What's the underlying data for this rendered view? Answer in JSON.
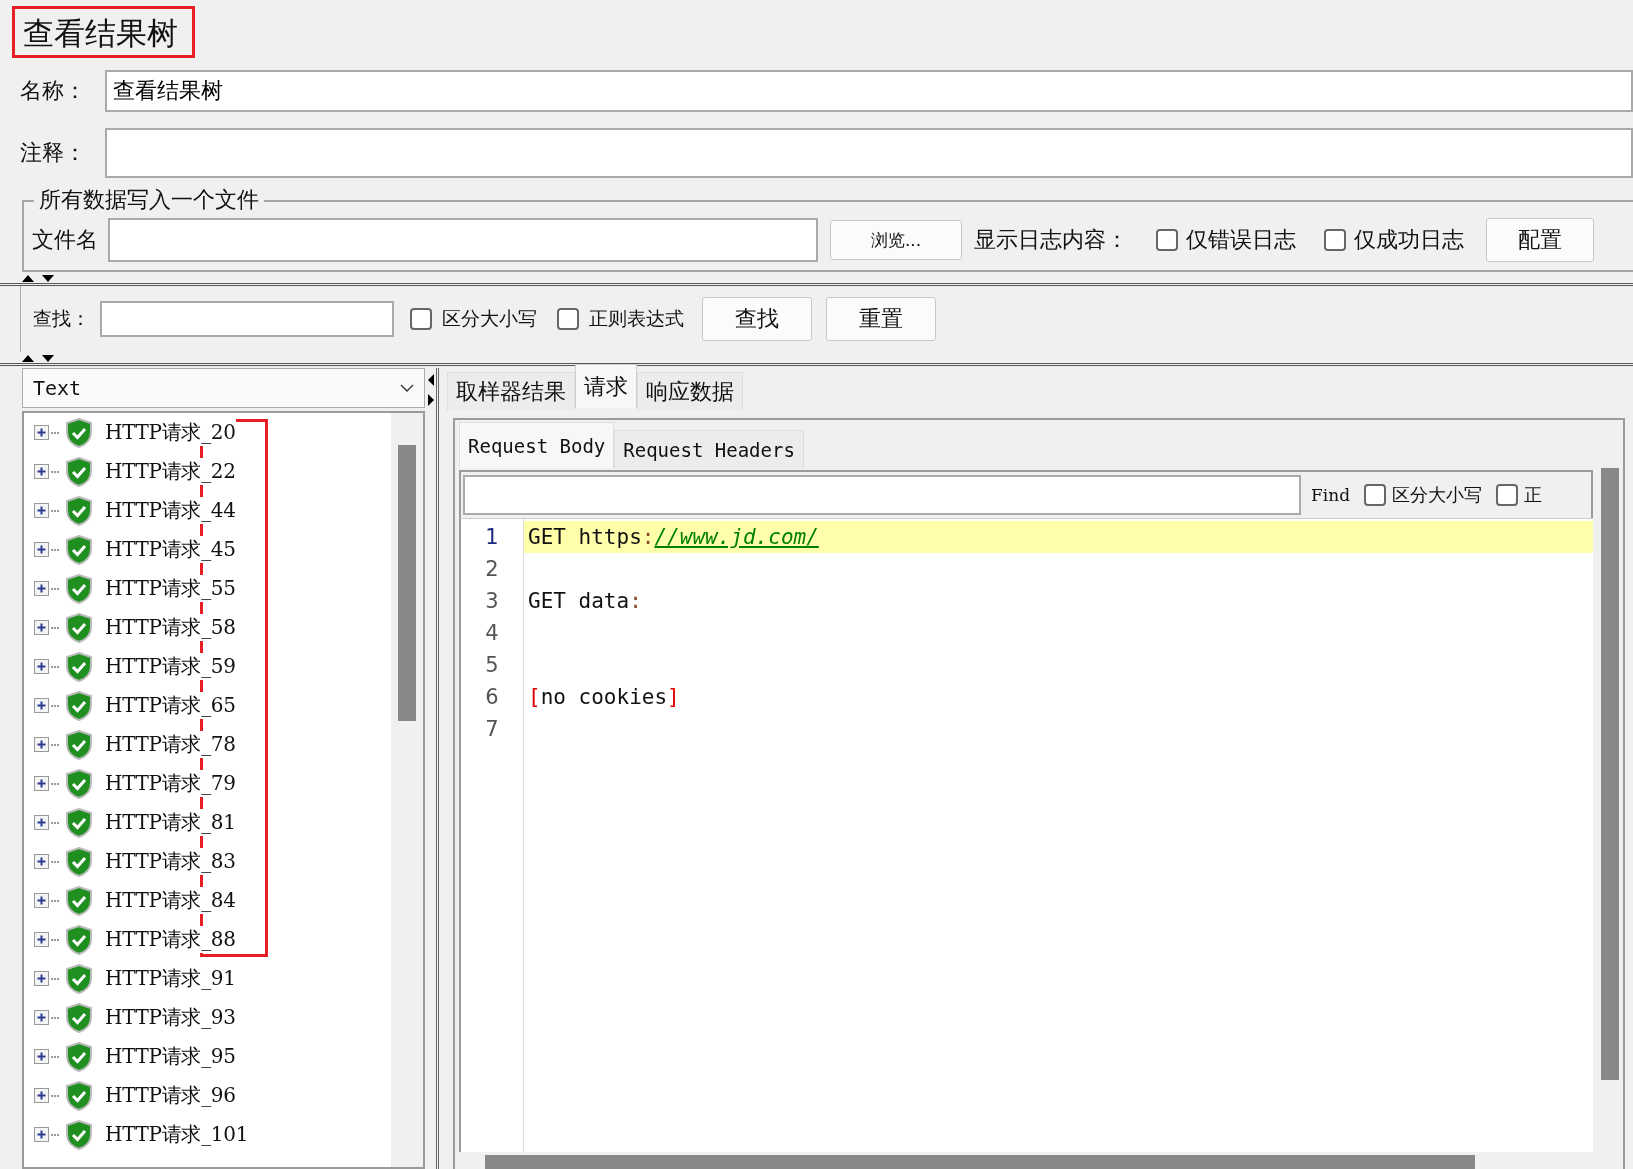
{
  "title": {
    "text": "查看结果树",
    "boxed": true
  },
  "name_field": {
    "label": "名称：",
    "value": "查看结果树"
  },
  "comment_field": {
    "label": "注释："
  },
  "file_section": {
    "legend": "所有数据写入一个文件",
    "file_label": "文件名",
    "browse_button": "浏览...",
    "log_label": "显示日志内容：",
    "checkboxes": [
      {
        "label": "仅错误日志",
        "checked": false
      },
      {
        "label": "仅成功日志",
        "checked": false
      }
    ],
    "config_button": "配置"
  },
  "search": {
    "label": "查找：",
    "checkboxes": [
      {
        "label": "区分大小写",
        "checked": false
      },
      {
        "label": "正则表达式",
        "checked": false
      }
    ],
    "buttons": [
      "查找",
      "重置"
    ]
  },
  "renderer_combo": {
    "value": "Text"
  },
  "tree": {
    "items": [
      {
        "label": "HTTP请求_20",
        "expanded": false,
        "marked": true
      },
      {
        "label": "HTTP请求_22",
        "expanded": false,
        "marked": true
      },
      {
        "label": "HTTP请求_44",
        "expanded": false,
        "marked": true
      },
      {
        "label": "HTTP请求_45",
        "expanded": false,
        "marked": true
      },
      {
        "label": "HTTP请求_55",
        "expanded": false,
        "marked": true
      },
      {
        "label": "HTTP请求_58",
        "expanded": false,
        "marked": true
      },
      {
        "label": "HTTP请求_59",
        "expanded": false,
        "marked": true
      },
      {
        "label": "HTTP请求_65",
        "expanded": false,
        "marked": true
      },
      {
        "label": "HTTP请求_78",
        "expanded": false,
        "marked": true
      },
      {
        "label": "HTTP请求_79",
        "expanded": false,
        "marked": true
      },
      {
        "label": "HTTP请求_81",
        "expanded": false,
        "marked": true
      },
      {
        "label": "HTTP请求_83",
        "expanded": false,
        "marked": true
      },
      {
        "label": "HTTP请求_84",
        "expanded": false,
        "marked": true
      },
      {
        "label": "HTTP请求_88",
        "expanded": false,
        "marked": true
      },
      {
        "label": "HTTP请求_91",
        "expanded": false,
        "marked": false
      },
      {
        "label": "HTTP请求_93",
        "expanded": false,
        "marked": false
      },
      {
        "label": "HTTP请求_95",
        "expanded": false,
        "marked": false
      },
      {
        "label": "HTTP请求_96",
        "expanded": false,
        "marked": false
      },
      {
        "label": "HTTP请求_101",
        "expanded": false,
        "marked": false
      }
    ]
  },
  "result_tabs": [
    {
      "label": "取样器结果",
      "selected": false
    },
    {
      "label": "请求",
      "selected": true
    },
    {
      "label": "响应数据",
      "selected": false
    }
  ],
  "request_tabs": [
    {
      "label": "Request Body",
      "selected": true
    },
    {
      "label": "Request Headers",
      "selected": false
    }
  ],
  "find_bar": {
    "label": "Find",
    "checkboxes": [
      {
        "label": "区分大小写",
        "checked": false
      },
      {
        "label": "正",
        "checked": false
      }
    ]
  },
  "editor": {
    "lines": [
      {
        "number": "1",
        "highlighted": true,
        "segments": [
          {
            "kind": "text",
            "text": "GET https"
          },
          {
            "kind": "punct",
            "text": ":"
          },
          {
            "kind": "link",
            "text": "//www.jd.com/"
          }
        ]
      },
      {
        "number": "2",
        "highlighted": false
      },
      {
        "number": "3",
        "highlighted": false,
        "segments": [
          {
            "kind": "text",
            "text": "GET data"
          },
          {
            "kind": "punct",
            "text": ":"
          }
        ]
      },
      {
        "number": "4",
        "highlighted": false
      },
      {
        "number": "5",
        "highlighted": false
      },
      {
        "number": "6",
        "highlighted": false,
        "segments": [
          {
            "kind": "bracket",
            "text": "["
          },
          {
            "kind": "text",
            "text": "no cookies"
          },
          {
            "kind": "bracket",
            "text": "]"
          }
        ]
      },
      {
        "number": "7",
        "highlighted": false
      }
    ]
  }
}
